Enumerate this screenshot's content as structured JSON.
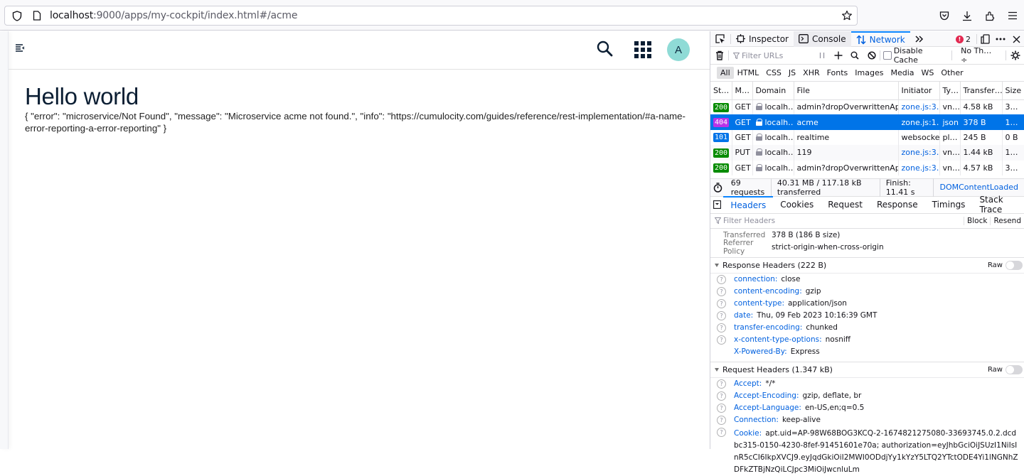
{
  "browser": {
    "url_host": "localhost",
    "url_rest": ":9000/apps/my-cockpit/index.html#/acme",
    "icons": [
      "shield-icon",
      "page-icon",
      "bookmark-star-icon",
      "pocket-icon",
      "download-icon",
      "extensions-icon",
      "hamburger-menu-icon"
    ]
  },
  "page": {
    "avatar_letter": "A",
    "title": "Hello world",
    "error_json": "{ \"error\": \"microservice/Not Found\", \"message\": \"Microservice acme not found.\", \"info\": \"https://cumulocity.com/guides/reference/rest-implementation/#a-name-error-reporting-a-error-reporting\" }"
  },
  "devtools": {
    "tabs": [
      {
        "label": "Inspector"
      },
      {
        "label": "Console"
      },
      {
        "label": "Network",
        "active": true
      }
    ],
    "error_count": "2",
    "toolbar": {
      "filter_placeholder": "Filter URLs",
      "disable_cache_label": "Disable Cache",
      "throttle_label": "No Th… ÷"
    },
    "type_filters": [
      "All",
      "HTML",
      "CSS",
      "JS",
      "XHR",
      "Fonts",
      "Images",
      "Media",
      "WS",
      "Other"
    ],
    "columns": [
      "St…",
      "M…",
      "Domain",
      "File",
      "Initiator",
      "Ty…",
      "Transfer…",
      "Size"
    ],
    "requests": [
      {
        "status": "200",
        "status_color": "#058b00",
        "method": "GET",
        "domain": "localh…",
        "file": "admin?dropOverwrittenApps=fa",
        "initiator": "zone.js:3…",
        "type": "vn…",
        "transferred": "4.58 kB",
        "size": "3…"
      },
      {
        "status": "404",
        "status_color": "#b833e8",
        "method": "GET",
        "domain": "localh…",
        "file": "acme",
        "initiator": "zone.js:1…",
        "type": "json",
        "transferred": "378 B",
        "size": "1…",
        "selected": true
      },
      {
        "status": "101",
        "status_color": "#0074e8",
        "method": "GET",
        "domain": "localh…",
        "file": "realtime",
        "initiator": "websocket",
        "type": "pl…",
        "transferred": "245 B",
        "size": "0 B"
      },
      {
        "status": "200",
        "status_color": "#058b00",
        "method": "PUT",
        "domain": "localh…",
        "file": "119",
        "initiator": "zone.js:3…",
        "type": "vn…",
        "transferred": "1.44 kB",
        "size": "1…"
      },
      {
        "status": "200",
        "status_color": "#058b00",
        "method": "GET",
        "domain": "localh…",
        "file": "admin?dropOverwrittenApps=tr",
        "initiator": "zone.js:3…",
        "type": "vn…",
        "transferred": "4.57 kB",
        "size": "3…"
      }
    ],
    "summary": {
      "requests": "69 requests",
      "transferred": "40.31 MB / 117.18 kB transferred",
      "finish": "Finish: 11.41 s",
      "dom_loaded": "DOMContentLoaded"
    },
    "detail_tabs": [
      "Headers",
      "Cookies",
      "Request",
      "Response",
      "Timings",
      "Stack Trace"
    ],
    "header_filter_placeholder": "Filter Headers",
    "block_label": "Block",
    "resend_label": "Resend",
    "overview": [
      {
        "key": "Transferred",
        "value": "378 B (186 B size)"
      },
      {
        "key": "Referrer Policy",
        "value": "strict-origin-when-cross-origin"
      }
    ],
    "response_headers": {
      "title": "Response Headers (222 B)",
      "raw_label": "Raw",
      "items": [
        {
          "name": "connection:",
          "value": "close",
          "help": true
        },
        {
          "name": "content-encoding:",
          "value": "gzip",
          "help": true
        },
        {
          "name": "content-type:",
          "value": "application/json",
          "help": true
        },
        {
          "name": "date:",
          "value": "Thu, 09 Feb 2023 10:16:39 GMT",
          "help": true
        },
        {
          "name": "transfer-encoding:",
          "value": "chunked",
          "help": true
        },
        {
          "name": "x-content-type-options:",
          "value": "nosniff",
          "help": true
        },
        {
          "name": "X-Powered-By:",
          "value": "Express",
          "help": false
        }
      ]
    },
    "request_headers": {
      "title": "Request Headers (1.347 kB)",
      "raw_label": "Raw",
      "items": [
        {
          "name": "Accept:",
          "value": "*/*"
        },
        {
          "name": "Accept-Encoding:",
          "value": "gzip, deflate, br"
        },
        {
          "name": "Accept-Language:",
          "value": "en-US,en;q=0.5"
        },
        {
          "name": "Connection:",
          "value": "keep-alive"
        },
        {
          "name": "Cookie:",
          "value": "apt.uid=AP-98W68BOG3KCQ-2-1674821275080-33693745.0.2.dcdbc315-0150-4230-8fef-91451601e70a; authorization=eyJhbGciOiJSUzI1NiIsInR5cCI6IkpXVCJ9.eyJqdGkiOiI2MWI0ODdjYy1kYzY5LTQ2YTctODE4Yi1lNGNhZDFkZTBjNzQiLCJpc3MiOiJwcnluLm"
        }
      ]
    }
  }
}
